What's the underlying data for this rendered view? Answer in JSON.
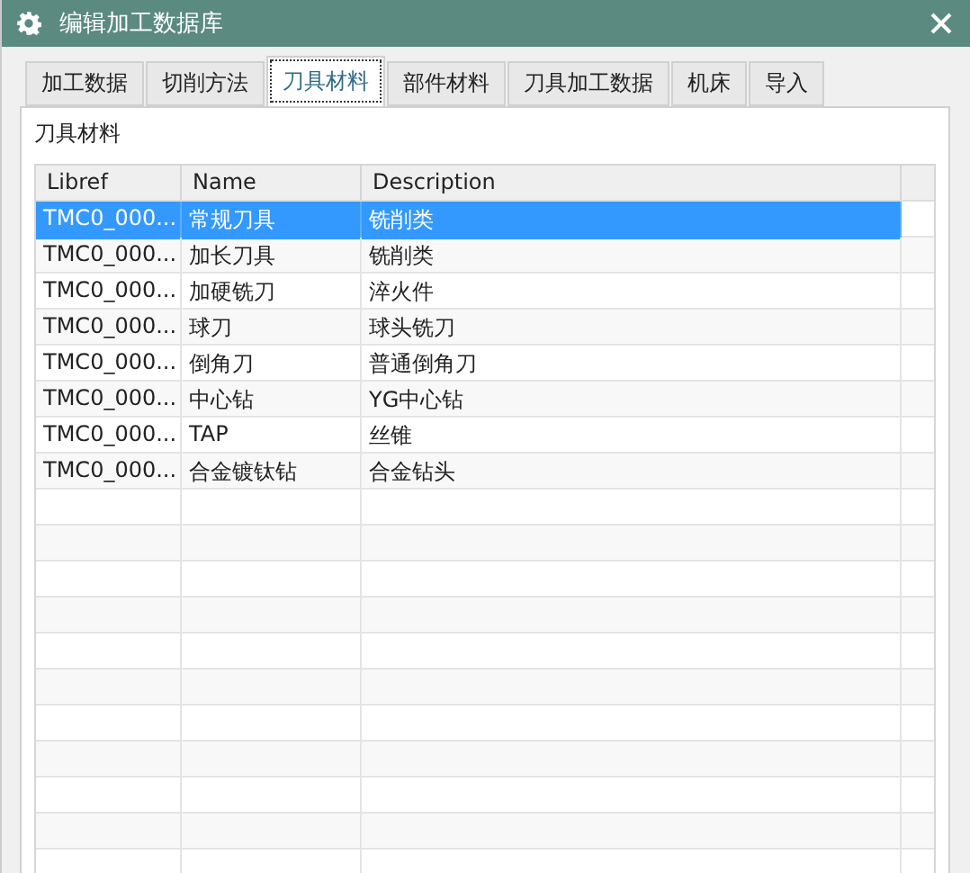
{
  "window": {
    "title": "编辑加工数据库"
  },
  "tabs": [
    {
      "label": "加工数据",
      "selected": false
    },
    {
      "label": "切削方法",
      "selected": false
    },
    {
      "label": "刀具材料",
      "selected": true
    },
    {
      "label": "部件材料",
      "selected": false
    },
    {
      "label": "刀具加工数据",
      "selected": false
    },
    {
      "label": "机床",
      "selected": false
    },
    {
      "label": "导入",
      "selected": false
    }
  ],
  "section_label": "刀具材料",
  "table": {
    "columns": [
      "Libref",
      "Name",
      "Description"
    ],
    "rows": [
      {
        "cells": [
          "TMC0_000...",
          "常规刀具",
          "铣削类"
        ],
        "selected": true
      },
      {
        "cells": [
          "TMC0_000...",
          "加长刀具",
          "铣削类"
        ],
        "selected": false
      },
      {
        "cells": [
          "TMC0_000...",
          "加硬铣刀",
          "淬火件"
        ],
        "selected": false
      },
      {
        "cells": [
          "TMC0_000...",
          "球刀",
          "球头铣刀"
        ],
        "selected": false
      },
      {
        "cells": [
          "TMC0_000...",
          "倒角刀",
          "普通倒角刀"
        ],
        "selected": false
      },
      {
        "cells": [
          "TMC0_000...",
          "中心钻",
          "YG中心钻"
        ],
        "selected": false
      },
      {
        "cells": [
          "TMC0_000...",
          "TAP",
          "丝锥"
        ],
        "selected": false
      },
      {
        "cells": [
          "TMC0_000...",
          "合金镀钛钻",
          "合金钻头"
        ],
        "selected": false
      }
    ]
  }
}
